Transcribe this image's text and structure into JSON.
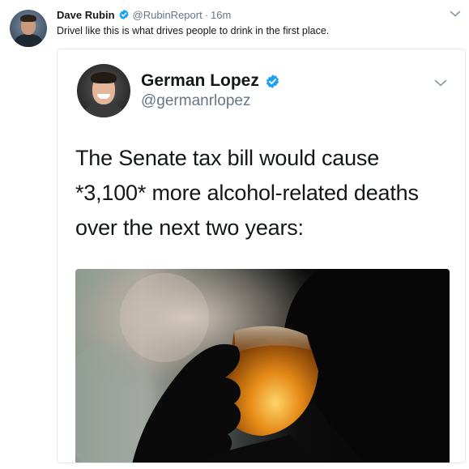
{
  "tweet": {
    "author_name": "Dave Rubin",
    "author_handle": "@RubinReport",
    "separator": "·",
    "timestamp": "16m",
    "text": "Drivel like this is what drives people to drink in the first place."
  },
  "quoted_tweet": {
    "author_name": "German Lopez",
    "author_handle": "@germanrlopez",
    "text_lines": [
      "The Senate tax bill would cause",
      "*3,100* more alcohol-related deaths",
      "over the next two years:"
    ]
  },
  "icons": {
    "verified": "verified-badge-icon",
    "more": "chevron-down-icon"
  },
  "colors": {
    "verified_blue": "#1da1f2",
    "secondary_text": "#657786",
    "border": "#e1e8ed"
  }
}
